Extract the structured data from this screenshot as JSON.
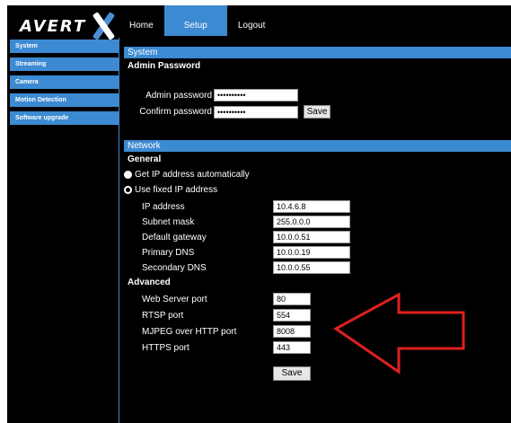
{
  "logo": {
    "text": "AVERT",
    "letter": "X"
  },
  "topnav": {
    "tabs": [
      {
        "label": "Home"
      },
      {
        "label": "Setup"
      },
      {
        "label": "Logout"
      }
    ],
    "active": "Setup"
  },
  "sidebar": {
    "items": [
      {
        "label": "System"
      },
      {
        "label": "Streaming"
      },
      {
        "label": "Camera"
      },
      {
        "label": "Motion Detection"
      },
      {
        "label": "Software upgrade"
      }
    ]
  },
  "system": {
    "title": "System",
    "subtitle": "Admin Password",
    "admin_password_label": "Admin password",
    "admin_password_value": "••••••••••",
    "confirm_password_label": "Confirm password",
    "confirm_password_value": "••••••••••",
    "save_label": "Save"
  },
  "network": {
    "title": "Network",
    "general_label": "General",
    "radio_auto": "Get IP address automatically",
    "radio_fixed": "Use fixed IP address",
    "fields": {
      "ip_label": "IP address",
      "ip_value": "10.4.6.8",
      "subnet_label": "Subnet mask",
      "subnet_value": "255.0.0.0",
      "gateway_label": "Default gateway",
      "gateway_value": "10.0.0.51",
      "dns1_label": "Primary DNS",
      "dns1_value": "10.0.0.19",
      "dns2_label": "Secondary DNS",
      "dns2_value": "10.0.0.55"
    },
    "advanced_label": "Advanced",
    "ports": {
      "web_label": "Web Server port",
      "web_value": "80",
      "rtsp_label": "RTSP port",
      "rtsp_value": "554",
      "mjpeg_label": "MJPEG over HTTP port",
      "mjpeg_value": "8008",
      "https_label": "HTTPS port",
      "https_value": "443"
    },
    "save_label": "Save"
  },
  "colors": {
    "accent": "#3c8ad2",
    "background": "#000000",
    "arrow": "#e02020"
  }
}
